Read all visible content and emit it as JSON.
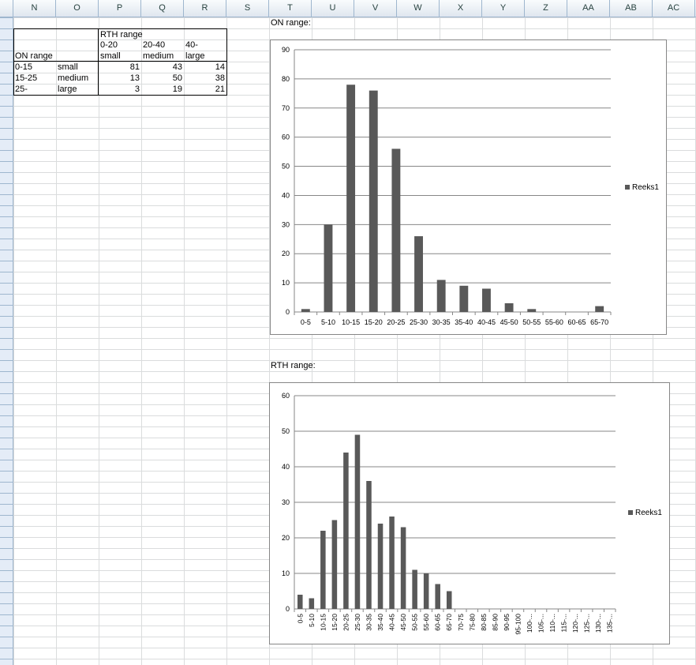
{
  "columns": [
    "N",
    "O",
    "P",
    "Q",
    "R",
    "S",
    "T",
    "U",
    "V",
    "W",
    "X",
    "Y",
    "Z",
    "AA",
    "AB",
    "AC"
  ],
  "table": {
    "rth_header": "RTH range",
    "col_headers": [
      {
        "range": "0-20",
        "size": "small"
      },
      {
        "range": "20-40",
        "size": "medium"
      },
      {
        "range": "40-",
        "size": "large"
      }
    ],
    "on_header": "ON range",
    "rows": [
      {
        "range": "0-15",
        "size": "small",
        "values": [
          "81",
          "43",
          "14"
        ]
      },
      {
        "range": "15-25",
        "size": "medium",
        "values": [
          "13",
          "50",
          "38"
        ]
      },
      {
        "range": "25-",
        "size": "large",
        "values": [
          "3",
          "19",
          "21"
        ]
      }
    ]
  },
  "labels": {
    "on_chart_title": "ON range:",
    "rth_chart_title": "RTH range:"
  },
  "chart_data": [
    {
      "type": "bar",
      "categories": [
        "0-5",
        "5-10",
        "10-15",
        "15-20",
        "20-25",
        "25-30",
        "30-35",
        "35-40",
        "40-45",
        "45-50",
        "50-55",
        "55-60",
        "60-65",
        "65-70"
      ],
      "series": [
        {
          "name": "Reeks1",
          "values": [
            1,
            30,
            78,
            76,
            56,
            26,
            11,
            9,
            8,
            3,
            1,
            0,
            0,
            2
          ]
        }
      ],
      "ylim": [
        0,
        90
      ],
      "yticks": [
        0,
        10,
        20,
        30,
        40,
        50,
        60,
        70,
        80,
        90
      ],
      "grid": true,
      "legend": "right",
      "bar_color": "#595959"
    },
    {
      "type": "bar",
      "categories": [
        "0-5",
        "5-10",
        "10-15",
        "15-20",
        "20-25",
        "25-30",
        "30-35",
        "35-40",
        "40-45",
        "45-50",
        "50-55",
        "55-60",
        "60-65",
        "65-70",
        "70-75",
        "75-80",
        "80-85",
        "85-90",
        "90-95",
        "95-100",
        "100-...",
        "105-...",
        "110-...",
        "115-...",
        "120-...",
        "125-...",
        "130-...",
        "135-..."
      ],
      "series": [
        {
          "name": "Reeks1",
          "values": [
            4,
            3,
            22,
            25,
            44,
            49,
            36,
            24,
            26,
            23,
            11,
            10,
            7,
            5,
            0,
            0,
            0,
            0,
            0,
            0,
            0,
            0,
            0,
            0,
            0,
            0,
            0,
            0
          ]
        }
      ],
      "ylim": [
        0,
        60
      ],
      "yticks": [
        0,
        10,
        20,
        30,
        40,
        50,
        60
      ],
      "grid": true,
      "legend": "right",
      "bar_color": "#595959"
    }
  ]
}
